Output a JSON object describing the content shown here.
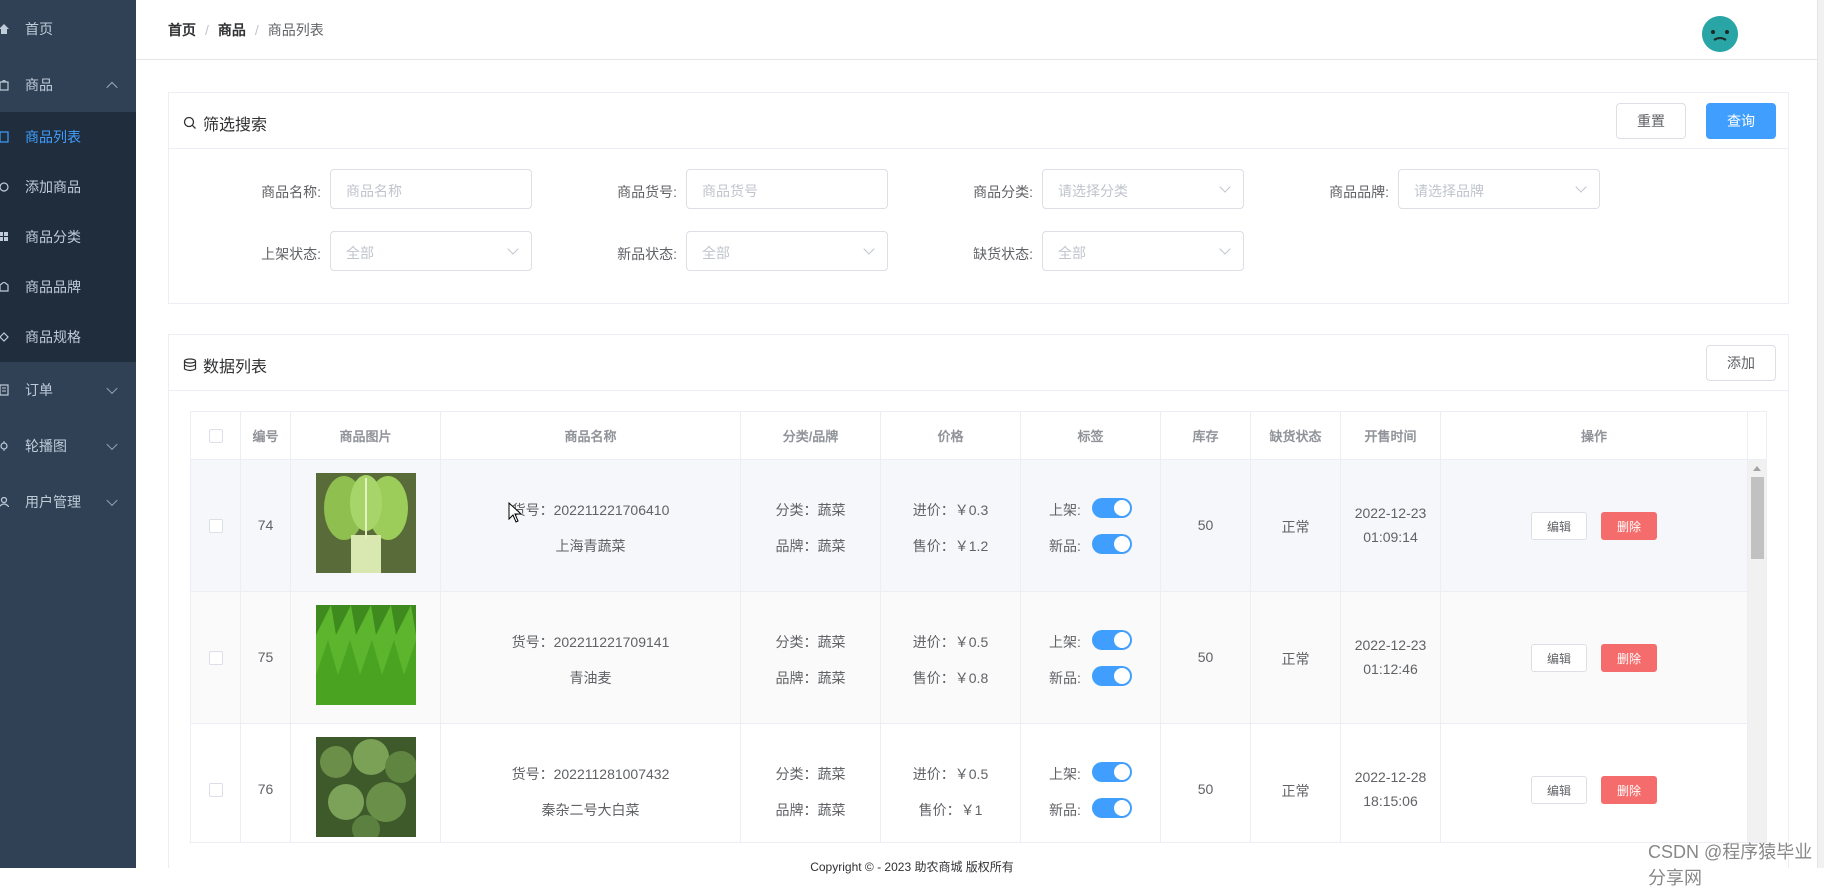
{
  "sidebar": {
    "items": [
      {
        "label": "首页",
        "icon": "home-icon"
      },
      {
        "label": "商品",
        "icon": "goods-icon",
        "expanded": true
      },
      {
        "label": "商品列表",
        "icon": "list-icon",
        "active": true
      },
      {
        "label": "添加商品",
        "icon": "add-circle-icon"
      },
      {
        "label": "商品分类",
        "icon": "grid-icon"
      },
      {
        "label": "商品品牌",
        "icon": "brand-icon"
      },
      {
        "label": "商品规格",
        "icon": "spec-icon"
      },
      {
        "label": "订单",
        "icon": "order-icon"
      },
      {
        "label": "轮播图",
        "icon": "carousel-icon"
      },
      {
        "label": "用户管理",
        "icon": "user-icon"
      }
    ],
    "bg_color": "#304156",
    "active_color": "#409eff"
  },
  "header": {
    "breadcrumb": [
      "首页",
      "商品",
      "商品列表"
    ],
    "separator": "/"
  },
  "filter": {
    "title": "筛选搜索",
    "reset_label": "重置",
    "query_label": "查询",
    "fields": [
      {
        "label": "商品名称:",
        "placeholder": "商品名称"
      },
      {
        "label": "商品货号:",
        "placeholder": "商品货号"
      },
      {
        "label": "商品分类:",
        "placeholder": "请选择分类"
      },
      {
        "label": "商品品牌:",
        "placeholder": "请选择品牌"
      },
      {
        "label": "上架状态:",
        "placeholder": "全部"
      },
      {
        "label": "新品状态:",
        "placeholder": "全部"
      },
      {
        "label": "缺货状态:",
        "placeholder": "全部"
      }
    ]
  },
  "list": {
    "title": "数据列表",
    "add_label": "添加",
    "columns": [
      "编号",
      "商品图片",
      "商品名称",
      "分类/品牌",
      "价格",
      "标签",
      "库存",
      "缺货状态",
      "开售时间",
      "操作"
    ],
    "rows": [
      {
        "id": "74",
        "sku": "货号：202211221706410",
        "name": "上海青蔬菜",
        "category": "分类：蔬菜",
        "brand": "品牌：蔬菜",
        "cost": "进价：￥0.3",
        "price": "售价：￥1.2",
        "tag_onsale": "上架:",
        "tag_new": "新品:",
        "stock": "50",
        "stock_status": "正常",
        "date": "2022-12-23",
        "time": "01:09:14",
        "edit": "编辑",
        "delete": "删除"
      },
      {
        "id": "75",
        "sku": "货号：202211221709141",
        "name": "青油麦",
        "category": "分类：蔬菜",
        "brand": "品牌：蔬菜",
        "cost": "进价：￥0.5",
        "price": "售价：￥0.8",
        "tag_onsale": "上架:",
        "tag_new": "新品:",
        "stock": "50",
        "stock_status": "正常",
        "date": "2022-12-23",
        "time": "01:12:46",
        "edit": "编辑",
        "delete": "删除"
      },
      {
        "id": "76",
        "sku": "货号：202211281007432",
        "name": "秦杂二号大白菜",
        "category": "分类：蔬菜",
        "brand": "品牌：蔬菜",
        "cost": "进价：￥0.5",
        "price": "售价：￥1",
        "tag_onsale": "上架:",
        "tag_new": "新品:",
        "stock": "50",
        "stock_status": "正常",
        "date": "2022-12-28",
        "time": "18:15:06",
        "edit": "编辑",
        "delete": "删除"
      }
    ]
  },
  "footer": {
    "text": "Copyright © - 2023 助农商城 版权所有"
  },
  "watermark": "CSDN @程序猿毕业分享网",
  "colors": {
    "primary": "#409eff",
    "danger": "#f56c6c"
  }
}
